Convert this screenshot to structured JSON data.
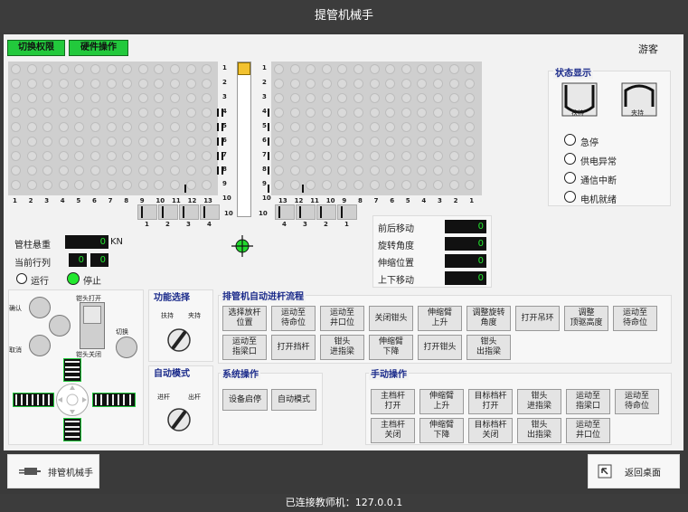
{
  "header": {
    "title": "提管机械手"
  },
  "toolbar": {
    "switch_permission": "切换权限",
    "hardware_operation": "硬件操作",
    "guest": "游客"
  },
  "racks": {
    "left_row_labels": [
      "1",
      "2",
      "3",
      "4",
      "5",
      "6",
      "7",
      "8",
      "9",
      "10"
    ],
    "right_row_labels": [
      "1",
      "2",
      "3",
      "4",
      "5",
      "6",
      "7",
      "8",
      "9",
      "10"
    ],
    "left_col_labels": [
      "1",
      "2",
      "3",
      "4",
      "5",
      "6",
      "7",
      "8",
      "9",
      "10",
      "11",
      "12",
      "13"
    ],
    "right_col_labels": [
      "13",
      "12",
      "11",
      "10",
      "9",
      "8",
      "7",
      "6",
      "5",
      "4",
      "3",
      "2",
      "1"
    ],
    "left_finger_labels": [
      "1",
      "2",
      "3",
      "4"
    ],
    "right_finger_labels": [
      "4",
      "3",
      "2",
      "1"
    ]
  },
  "readouts": {
    "hook_load_label": "管柱悬重",
    "hook_load_value": "0",
    "hook_load_unit": "KN",
    "current_row_col_label": "当前行列",
    "row_value": "0",
    "col_value": "0",
    "run_label": "运行",
    "stop_label": "停止",
    "fore_aft_label": "前后移动",
    "fore_aft_value": "0",
    "rotation_label": "旋转角度",
    "rotation_value": "0",
    "extend_label": "伸缩位置",
    "extend_value": "0",
    "updown_label": "上下移动",
    "updown_value": "0"
  },
  "status": {
    "title": "状态显示",
    "hold_label": "扶持",
    "clamp_label": "夹持",
    "items": [
      "急停",
      "供电异常",
      "通信中断",
      "电机就绪"
    ]
  },
  "controls": {
    "confirm": "确认",
    "cancel": "取消",
    "jaw_open": "钳头打开",
    "jaw_close": "钳头关闭",
    "switch": "切换"
  },
  "function_select": {
    "title": "功能选择",
    "left": "扶持",
    "right": "夹持"
  },
  "auto_mode": {
    "title": "自动模式",
    "left": "进杆",
    "right": "出杆"
  },
  "auto_flow": {
    "title": "排管机自动进杆流程",
    "row1": [
      "选择放杆\n位置",
      "运动至\n待命位",
      "运动至\n井口位",
      "关闭钳头",
      "伸缩臂\n上升",
      "调整旋转\n角度",
      "打开吊环",
      "调整\n顶驱高度",
      "运动至\n待命位"
    ],
    "row2": [
      "运动至\n指梁口",
      "打开挡杆",
      "钳头\n进指梁",
      "伸缩臂\n下降",
      "打开钳头",
      "钳头\n出指梁"
    ]
  },
  "system_ops": {
    "title": "系统操作",
    "start_stop": "设备启停",
    "auto_mode": "自动模式"
  },
  "manual_ops": {
    "title": "手动操作",
    "row1": [
      "主档杆\n打开",
      "伸缩臂\n上升",
      "目标档杆\n打开",
      "钳头\n进指梁",
      "运动至\n指梁口",
      "运动至\n待命位"
    ],
    "row2": [
      "主档杆\n关闭",
      "伸缩臂\n下降",
      "目标档杆\n关闭",
      "钳头\n出指梁",
      "运动至\n井口位"
    ]
  },
  "nav": {
    "left": "排管机械手",
    "right": "返回桌面"
  },
  "footer": {
    "status": "已连接教师机：127.0.0.1"
  }
}
